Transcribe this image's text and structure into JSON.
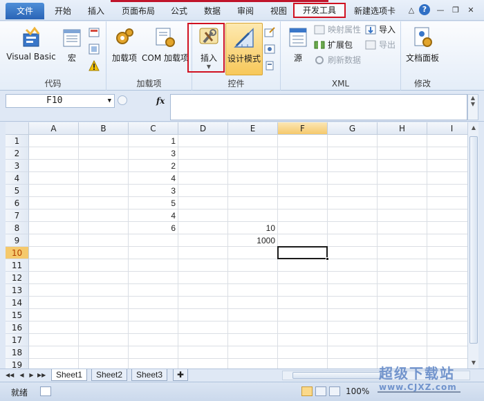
{
  "tabs": [
    {
      "label": "文件"
    },
    {
      "label": "开始"
    },
    {
      "label": "插入"
    },
    {
      "label": "页面布局"
    },
    {
      "label": "公式"
    },
    {
      "label": "数据"
    },
    {
      "label": "审阅"
    },
    {
      "label": "视图"
    },
    {
      "label": "开发工具"
    },
    {
      "label": "新建选项卡"
    }
  ],
  "ribbon": {
    "code": {
      "label": "代码",
      "visual_basic": "Visual Basic",
      "macro": "宏"
    },
    "addins": {
      "label": "加载项",
      "addin": "加载项",
      "com_addin": "COM 加载项"
    },
    "controls": {
      "label": "控件",
      "insert": "插入",
      "design_mode": "设计模式"
    },
    "xml": {
      "label": "XML",
      "source": "源",
      "map_props": "映射属性",
      "expansion": "扩展包",
      "refresh": "刷新数据",
      "import": "导入",
      "export": "导出"
    },
    "modify": {
      "label": "修改",
      "doc_panel": "文档面板"
    }
  },
  "formula_bar": {
    "name_box": "F10",
    "fx": "fx",
    "content": ""
  },
  "columns": [
    "A",
    "B",
    "C",
    "D",
    "E",
    "F",
    "G",
    "H",
    "I"
  ],
  "rows": [
    "1",
    "2",
    "3",
    "4",
    "5",
    "6",
    "7",
    "8",
    "9",
    "10",
    "11",
    "12",
    "13",
    "14",
    "15",
    "16",
    "17",
    "18",
    "19"
  ],
  "cells": {
    "C1": "1",
    "C2": "3",
    "C3": "2",
    "C4": "4",
    "C5": "3",
    "C6": "5",
    "C7": "4",
    "C8": "6",
    "E8": "10",
    "E9": "1000"
  },
  "active_cell": "F10",
  "sheets": [
    "Sheet1",
    "Sheet2",
    "Sheet3"
  ],
  "status": {
    "text": "就绪",
    "zoom": "100%"
  },
  "watermark": {
    "text": "超级下载站",
    "url": "www.CJXZ.com"
  },
  "colors": {
    "accent_red": "#d01020",
    "file_tab": "#2a64b6",
    "selected_header": "#f5c96c"
  }
}
